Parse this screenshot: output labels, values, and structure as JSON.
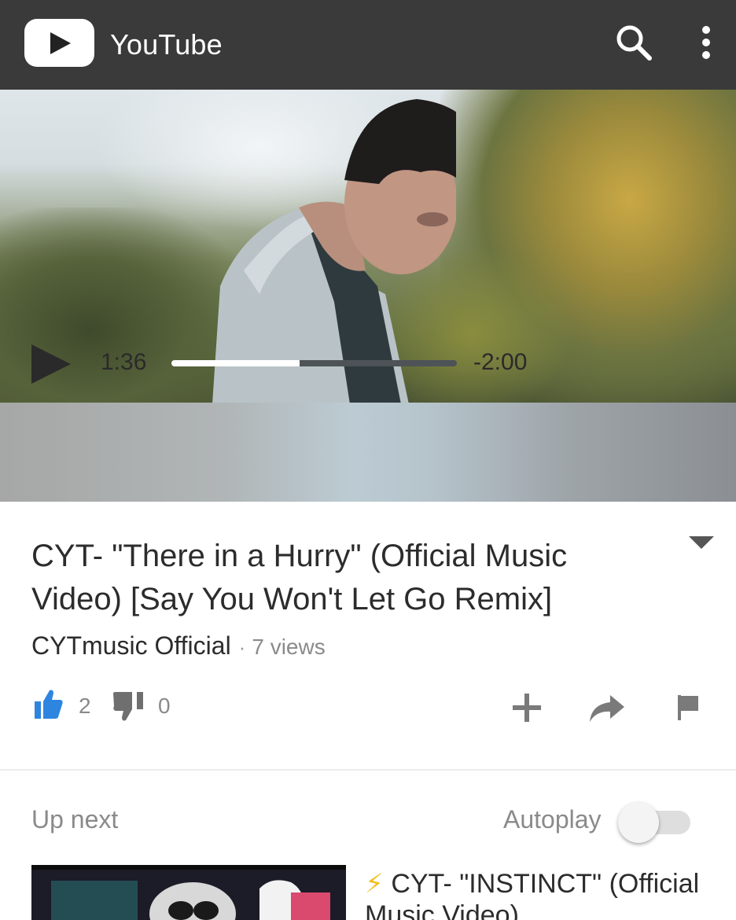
{
  "app": {
    "title": "YouTube"
  },
  "player": {
    "elapsed": "1:36",
    "remaining": "-2:00",
    "progress": 0.45
  },
  "video": {
    "title": "CYT- \"There in a Hurry\" (Official Music Video) [Say You Won't Let Go Remix]",
    "channel": "CYTmusic Official",
    "separator": "·",
    "views": "7 views",
    "likes": "2",
    "dislikes": "0"
  },
  "up_next": {
    "label": "Up next",
    "autoplay_label": "Autoplay",
    "autoplay_on": false,
    "items": [
      {
        "bolt": "⚡",
        "title": "CYT- \"INSTINCT\" (Official Music Video)"
      }
    ]
  },
  "icons": {
    "logo": "youtube-play-icon",
    "search": "search-icon",
    "more": "more-vert-icon",
    "play": "play-icon",
    "expand": "expand-icon",
    "like": "thumb-up-icon",
    "dislike": "thumb-down-icon",
    "add": "add-to-playlist-icon",
    "share": "share-icon",
    "flag": "flag-icon"
  },
  "colors": {
    "appbar": "#3a3a3a",
    "like_active": "#2d85e0",
    "icon_gray": "#8a8a8a",
    "bolt": "#f3c021"
  }
}
